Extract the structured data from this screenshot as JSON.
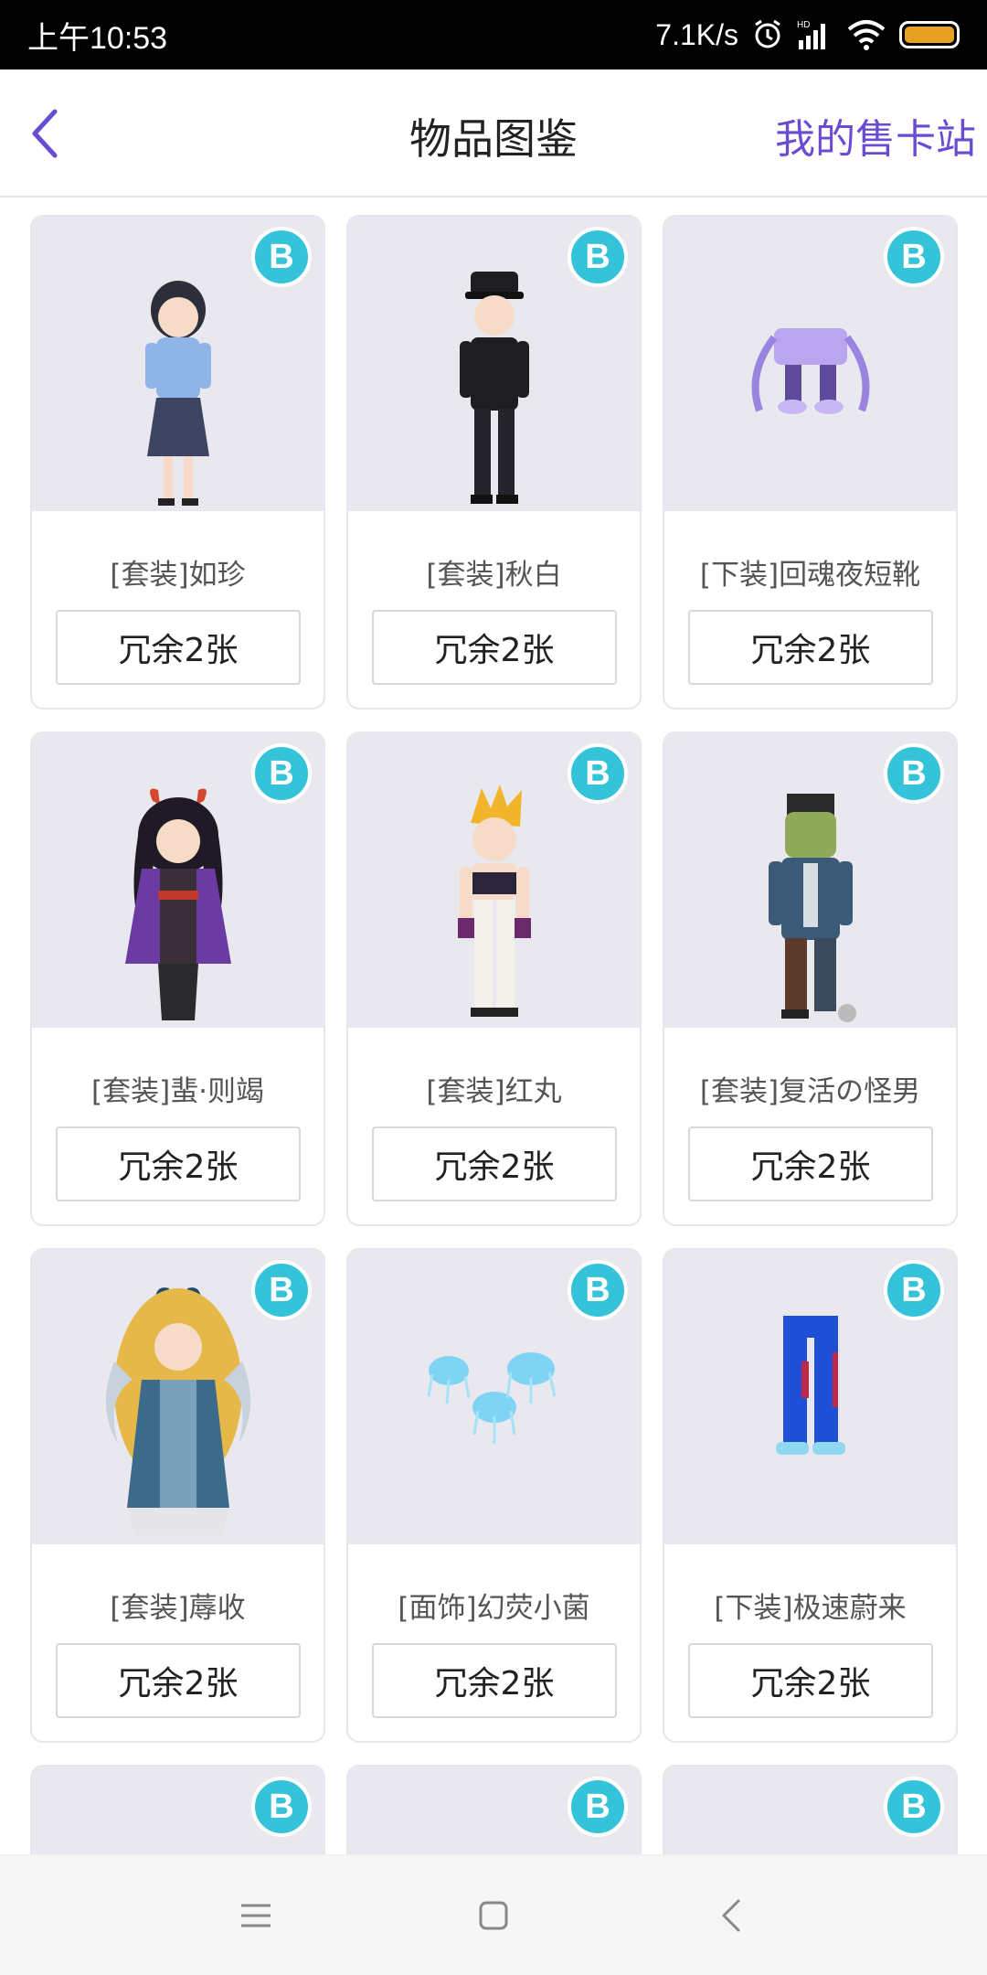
{
  "status_bar": {
    "time": "上午10:53",
    "speed": "7.1K/s",
    "icons": [
      "alarm-icon",
      "hd-signal-icon",
      "wifi-icon",
      "battery-icon"
    ],
    "battery_color": "#e8a223"
  },
  "header": {
    "back_icon": "chevron-left-icon",
    "title": "物品图鉴",
    "link": "我的售卡站",
    "accent_color": "#6a4cd2"
  },
  "items": [
    {
      "name": "[套装]如珍",
      "badge": "B",
      "button": "冗余2张",
      "image": "girl-blue-top-figure"
    },
    {
      "name": "[套装]秋白",
      "badge": "B",
      "button": "冗余2张",
      "image": "boy-black-uniform-figure"
    },
    {
      "name": "[下装]回魂夜短靴",
      "badge": "B",
      "button": "冗余2张",
      "image": "purple-shorts-boots"
    },
    {
      "name": "[套装]蜚·则竭",
      "badge": "B",
      "button": "冗余2张",
      "image": "demon-girl-purple-robe"
    },
    {
      "name": "[套装]红丸",
      "badge": "B",
      "button": "冗余2张",
      "image": "blonde-boy-white-pants"
    },
    {
      "name": "[套装]复活の怪男",
      "badge": "B",
      "button": "冗余2张",
      "image": "frankenstein-figure"
    },
    {
      "name": "[套装]蓐收",
      "badge": "B",
      "button": "冗余2张",
      "image": "golden-hair-deity-figure"
    },
    {
      "name": "[面饰]幻荧小菌",
      "badge": "B",
      "button": "冗余2张",
      "image": "glowing-jellyfish"
    },
    {
      "name": "[下装]极速蔚来",
      "badge": "B",
      "button": "冗余2张",
      "image": "blue-pants-sneakers"
    }
  ],
  "partial_badges": [
    "B",
    "B",
    "B"
  ],
  "badge_color": "#35c3da",
  "nav": {
    "icons": [
      "menu-icon",
      "home-square-icon",
      "back-triangle-icon"
    ]
  }
}
